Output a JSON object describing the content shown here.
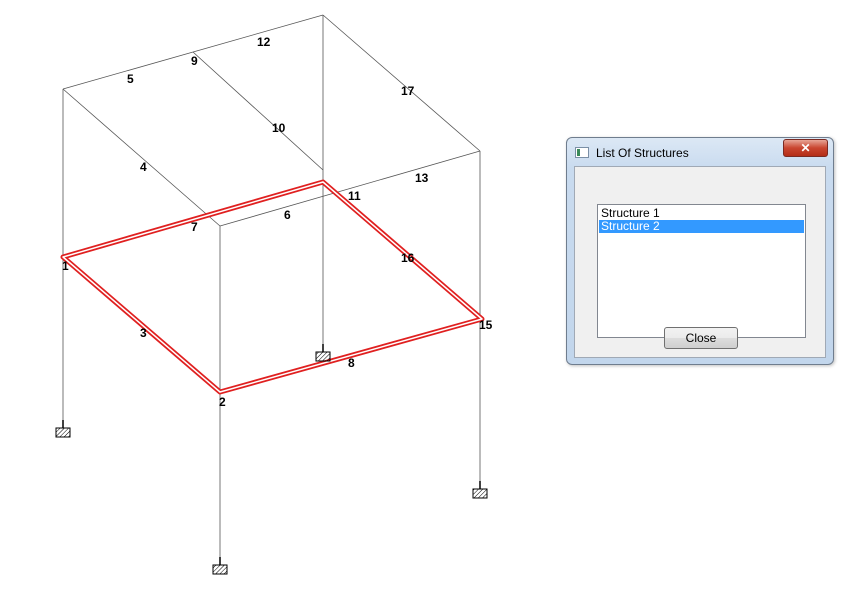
{
  "structure_labels": {
    "m1": "1",
    "m2": "2",
    "m3": "3",
    "m4": "4",
    "m5": "5",
    "m6": "6",
    "m7": "7",
    "m8": "8",
    "m9": "9",
    "m10": "10",
    "m11": "11",
    "m12": "12",
    "m13": "13",
    "m15": "15",
    "m16": "16",
    "m17": "17"
  },
  "dialog": {
    "title": "List Of Structures",
    "close_glyph": "✕",
    "items": [
      "Structure 1",
      "Structure 2"
    ],
    "selected_index": 1,
    "close_button_label": "Close"
  },
  "colors": {
    "selection_red": "#e02020",
    "list_selection": "#3399ff"
  },
  "icons": {
    "support": "fixed-support-icon",
    "dialog": "window-icon"
  }
}
